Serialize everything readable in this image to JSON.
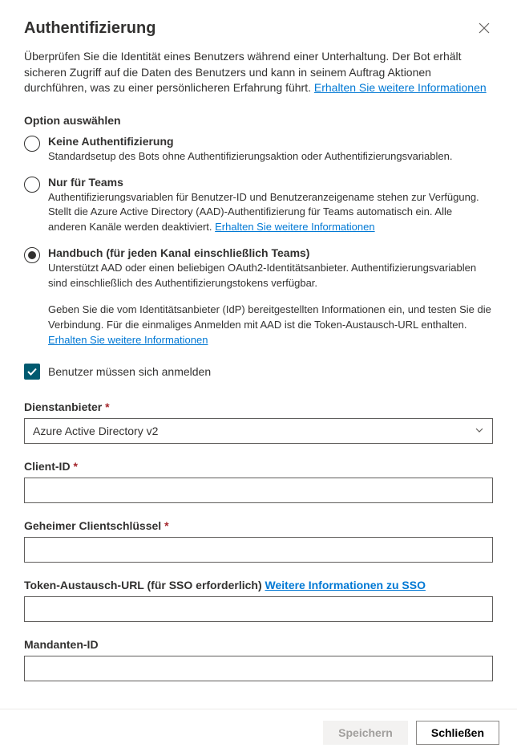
{
  "header": {
    "title": "Authentifizierung"
  },
  "intro": {
    "text": "Überprüfen Sie die Identität eines Benutzers während einer Unterhaltung. Der Bot erhält sicheren Zugriff auf die Daten des Benutzers und kann in seinem Auftrag Aktionen durchführen, was zu einer persönlicheren Erfahrung führt. ",
    "link": "Erhalten Sie weitere Informationen"
  },
  "optionSection": {
    "label": "Option auswählen",
    "options": [
      {
        "title": "Keine Authentifizierung",
        "desc": "Standardsetup des Bots ohne Authentifizierungsaktion oder Authentifizierungsvariablen.",
        "selected": false
      },
      {
        "title": "Nur für Teams",
        "desc": "Authentifizierungsvariablen für Benutzer-ID und Benutzeranzeigename stehen zur Verfügung. Stellt die Azure Active Directory (AAD)-Authentifizierung für Teams automatisch ein. Alle anderen Kanäle werden deaktiviert. ",
        "descLink": "Erhalten Sie weitere Informationen",
        "selected": false
      },
      {
        "title": "Handbuch (für jeden Kanal einschließlich Teams)",
        "desc": "Unterstützt AAD oder einen beliebigen OAuth2-Identitätsanbieter. Authentifizierungsvariablen sind einschließlich des Authentifizierungstokens verfügbar.",
        "note": "Geben Sie die vom Identitätsanbieter (IdP) bereitgestellten Informationen ein, und testen Sie die Verbindung. Für die einmaliges Anmelden mit AAD ist die Token-Austausch-URL enthalten. ",
        "noteLink": "Erhalten Sie weitere Informationen",
        "selected": true
      }
    ]
  },
  "requireSignIn": {
    "label": "Benutzer müssen sich anmelden",
    "checked": true
  },
  "fields": {
    "provider": {
      "label": "Dienstanbieter",
      "required": true,
      "value": "Azure Active Directory v2"
    },
    "clientId": {
      "label": "Client-ID",
      "required": true,
      "value": ""
    },
    "clientSecret": {
      "label": "Geheimer Clientschlüssel",
      "required": true,
      "value": ""
    },
    "tokenUrl": {
      "label": "Token-Austausch-URL (für SSO erforderlich) ",
      "link": "Weitere Informationen zu SSO",
      "required": false,
      "value": ""
    },
    "tenantId": {
      "label": "Mandanten-ID",
      "required": false,
      "value": ""
    }
  },
  "footer": {
    "save": "Speichern",
    "close": "Schließen"
  },
  "requiredMark": " *"
}
